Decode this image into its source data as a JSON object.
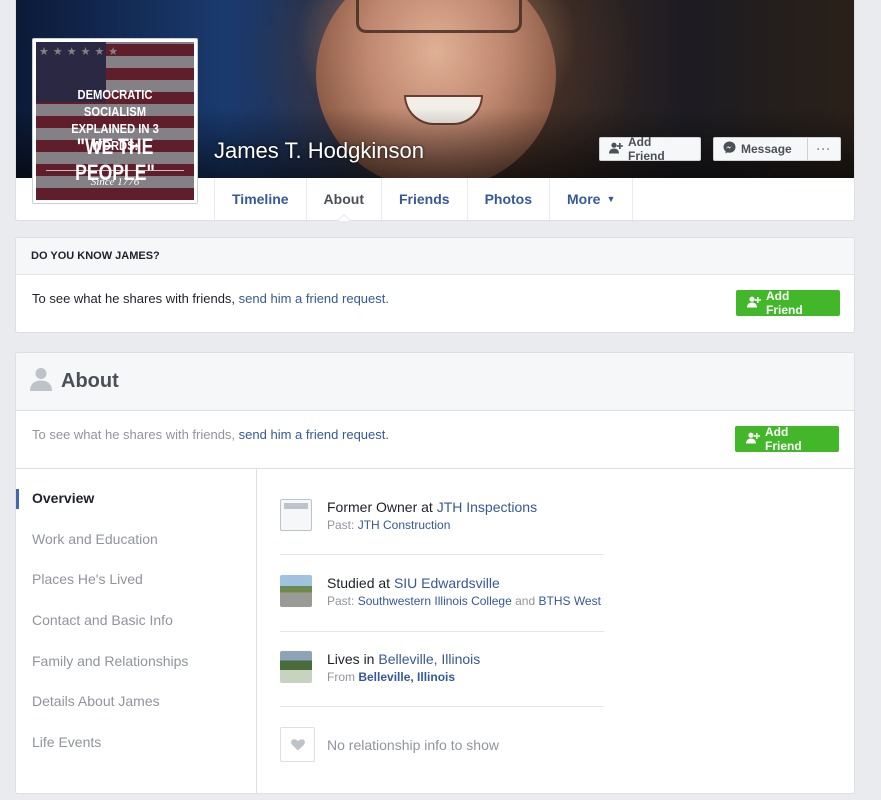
{
  "profile": {
    "name": "James T. Hodgkinson",
    "avatar": {
      "line1": "DEMOCRATIC SOCIALISM",
      "line2": "EXPLAINED IN 3 WORDS:",
      "line3": "\"WE THE PEOPLE\"",
      "line4": "Since 1776"
    }
  },
  "cover_actions": {
    "add_friend": "Add Friend",
    "message": "Message",
    "more": "···"
  },
  "tabs": [
    {
      "label": "Timeline"
    },
    {
      "label": "About"
    },
    {
      "label": "Friends"
    },
    {
      "label": "Photos"
    },
    {
      "label": "More"
    }
  ],
  "know_card": {
    "heading": "DO YOU KNOW JAMES?",
    "text": "To see what he shares with friends, ",
    "link": "send him a friend request.",
    "button": "Add Friend"
  },
  "about": {
    "title": "About",
    "prompt_text": "To see what he shares with friends, ",
    "prompt_link": "send him a friend request.",
    "button": "Add Friend",
    "nav": [
      "Overview",
      "Work and Education",
      "Places He's Lived",
      "Contact and Basic Info",
      "Family and Relationships",
      "Details About James",
      "Life Events"
    ],
    "work": {
      "prefix": "Former Owner at ",
      "link": "JTH Inspections",
      "sub_prefix": "Past: ",
      "sub_link": "JTH Construction"
    },
    "education": {
      "prefix": "Studied at ",
      "link": "SIU Edwardsville",
      "sub_prefix": "Past: ",
      "sub_link1": "Southwestern Illinois College",
      "sub_mid": " and ",
      "sub_link2": "BTHS West"
    },
    "lives": {
      "prefix": "Lives in ",
      "link": "Belleville, Illinois",
      "sub_prefix": "From ",
      "sub_link": "Belleville, Illinois"
    },
    "relationship": "No relationship info to show"
  },
  "colors": {
    "link": "#365899",
    "green": "#42b72a",
    "muted": "#90949c",
    "nav_accent": "#4267b2"
  }
}
